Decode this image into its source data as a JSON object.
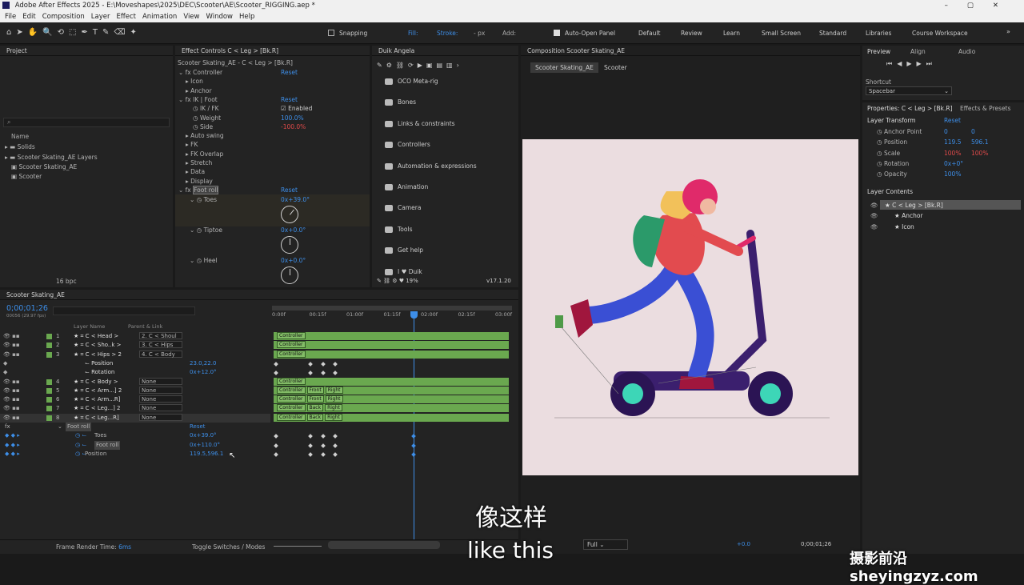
{
  "titlebar": {
    "title": "Adobe After Effects 2025 - E:\\Moveshapes\\2025\\DEC\\Scooter\\AE\\Scooter_RIGGING.aep *"
  },
  "menu": [
    "File",
    "Edit",
    "Composition",
    "Layer",
    "Effect",
    "Animation",
    "View",
    "Window",
    "Help"
  ],
  "toolbar": {
    "snapping": "Snapping",
    "fill": "Fill:",
    "stroke": "Stroke:",
    "stroke_px": "- px",
    "add": "Add:",
    "auto_open": "Auto-Open Panel",
    "workspaces": [
      "Default",
      "Review",
      "Learn",
      "Small Screen",
      "Standard",
      "Libraries",
      "Course Workspace"
    ]
  },
  "project": {
    "tab": "Project",
    "col_name": "Name",
    "items": [
      "Solids",
      "Scooter Skating_AE Layers",
      "Scooter Skating_AE",
      "Scooter"
    ],
    "bpc": "16 bpc"
  },
  "effects": {
    "tab": "Effect Controls C < Leg > [Bk.R]",
    "sub": "Scooter Skating_AE - C < Leg > [Bk.R]",
    "rows": [
      {
        "t": "Controller",
        "v": "Reset",
        "l": 0
      },
      {
        "t": "Icon",
        "v": "",
        "l": 1
      },
      {
        "t": "Anchor",
        "v": "",
        "l": 1
      },
      {
        "t": "IK | Foot",
        "v": "Reset",
        "l": 0
      },
      {
        "t": "IK / FK",
        "v": "Enabled",
        "l": 2
      },
      {
        "t": "Weight",
        "v": "100.0%",
        "l": 2
      },
      {
        "t": "Side",
        "v": "-100.0%",
        "l": 2
      },
      {
        "t": "Auto swing",
        "v": "",
        "l": 1
      },
      {
        "t": "FK",
        "v": "",
        "l": 1
      },
      {
        "t": "FK Overlap",
        "v": "",
        "l": 1
      },
      {
        "t": "Stretch",
        "v": "",
        "l": 1
      },
      {
        "t": "Data",
        "v": "",
        "l": 1
      },
      {
        "t": "Display",
        "v": "",
        "l": 1
      },
      {
        "t": "Foot roll",
        "v": "Reset",
        "l": 0
      }
    ],
    "toes": "Toes",
    "toes_v": "0x+39.0°",
    "tiptoe": "Tiptoe",
    "tiptoe_v": "0x+0.0°",
    "heel": "Heel",
    "heel_v": "0x+0.0°"
  },
  "duik": {
    "tab": "Duik Angela",
    "items": [
      "OCO Meta-rig",
      "Bones",
      "Links & constraints",
      "Controllers",
      "Automation & expressions",
      "Animation",
      "Camera",
      "Tools",
      "Get help",
      "I ♥ Duik"
    ],
    "pct": "19%",
    "ver": "v17.1.20"
  },
  "comp": {
    "tab": "Composition Scooter Skating_AE",
    "crumb1": "Scooter Skating_AE",
    "crumb2": "Scooter",
    "quality": "Full",
    "exposure": "+0.0",
    "time": "0;00;01;26"
  },
  "preview": {
    "tabs": [
      "Preview",
      "Align",
      "Audio"
    ],
    "shortcut_label": "Shortcut",
    "shortcut": "Spacebar"
  },
  "properties": {
    "tab": "Properties: C < Leg > [Bk.R]",
    "tab2": "Effects & Presets",
    "section": "Layer Transform",
    "reset": "Reset",
    "rows": [
      {
        "n": "Anchor Point",
        "a": "0",
        "b": "0"
      },
      {
        "n": "Position",
        "a": "119.5",
        "b": "596.1"
      },
      {
        "n": "Scale",
        "a": "100%",
        "b": "100%"
      },
      {
        "n": "Rotation",
        "a": "0x+0°",
        "b": ""
      },
      {
        "n": "Opacity",
        "a": "100%",
        "b": ""
      }
    ],
    "contents_label": "Layer Contents",
    "contents": [
      "C < Leg > [Bk.R]",
      "Anchor",
      "Icon"
    ]
  },
  "timeline": {
    "tab": "Scooter Skating_AE",
    "time": "0;00;01;26",
    "frames": "00056 (29.97 fps)",
    "col_layer": "Layer Name",
    "col_parent": "Parent & Link",
    "ticks": [
      "0:00f",
      "00:15f",
      "01:00f",
      "01:15f",
      "02:00f",
      "02:15f",
      "03:00f"
    ],
    "layers": [
      {
        "n": "1",
        "name": "C < Head >",
        "parent": "2. C < Shoul",
        "bar": [
          "Controller"
        ]
      },
      {
        "n": "2",
        "name": "C < Sho..k >",
        "parent": "3. C < Hips",
        "bar": [
          "Controller"
        ]
      },
      {
        "n": "3",
        "name": "C < Hips > 2",
        "parent": "4. C < Body",
        "bar": [
          "Controller"
        ]
      },
      {
        "n": "",
        "name": "Position",
        "parent": "",
        "val": "23.0,22.0"
      },
      {
        "n": "",
        "name": "Rotation",
        "parent": "",
        "val": "0x+12.0°"
      },
      {
        "n": "4",
        "name": "C < Body >",
        "parent": "None",
        "bar": [
          "Controller"
        ]
      },
      {
        "n": "5",
        "name": "C < Arm...] 2",
        "parent": "None",
        "bar": [
          "Controller",
          "Front",
          "Right"
        ]
      },
      {
        "n": "6",
        "name": "C < Arm...R]",
        "parent": "None",
        "bar": [
          "Controller",
          "Front",
          "Right"
        ]
      },
      {
        "n": "7",
        "name": "C < Leg...] 2",
        "parent": "None",
        "bar": [
          "Controller",
          "Back",
          "Right"
        ]
      },
      {
        "n": "8",
        "name": "C < Leg...R]",
        "parent": "None",
        "bar": [
          "Controller",
          "Back",
          "Right"
        ]
      }
    ],
    "fx": "Foot roll",
    "fx_reset": "Reset",
    "props": [
      {
        "n": "Toes",
        "v": "0x+39.0°"
      },
      {
        "n": "Foot roll",
        "v": "0x+110.0°"
      },
      {
        "n": "Position",
        "v": "119.5,596.1"
      }
    ],
    "render_label": "Frame Render Time:",
    "render_val": "6ms",
    "toggle": "Toggle Switches / Modes"
  },
  "subtitle": {
    "zh": "像这样",
    "en": "like this"
  },
  "watermark": "摄影前沿 sheyingzyz.com",
  "colors": {
    "accent": "#3d8ee8",
    "bar": "#6aa84f",
    "canvas": "#ebdde0"
  }
}
